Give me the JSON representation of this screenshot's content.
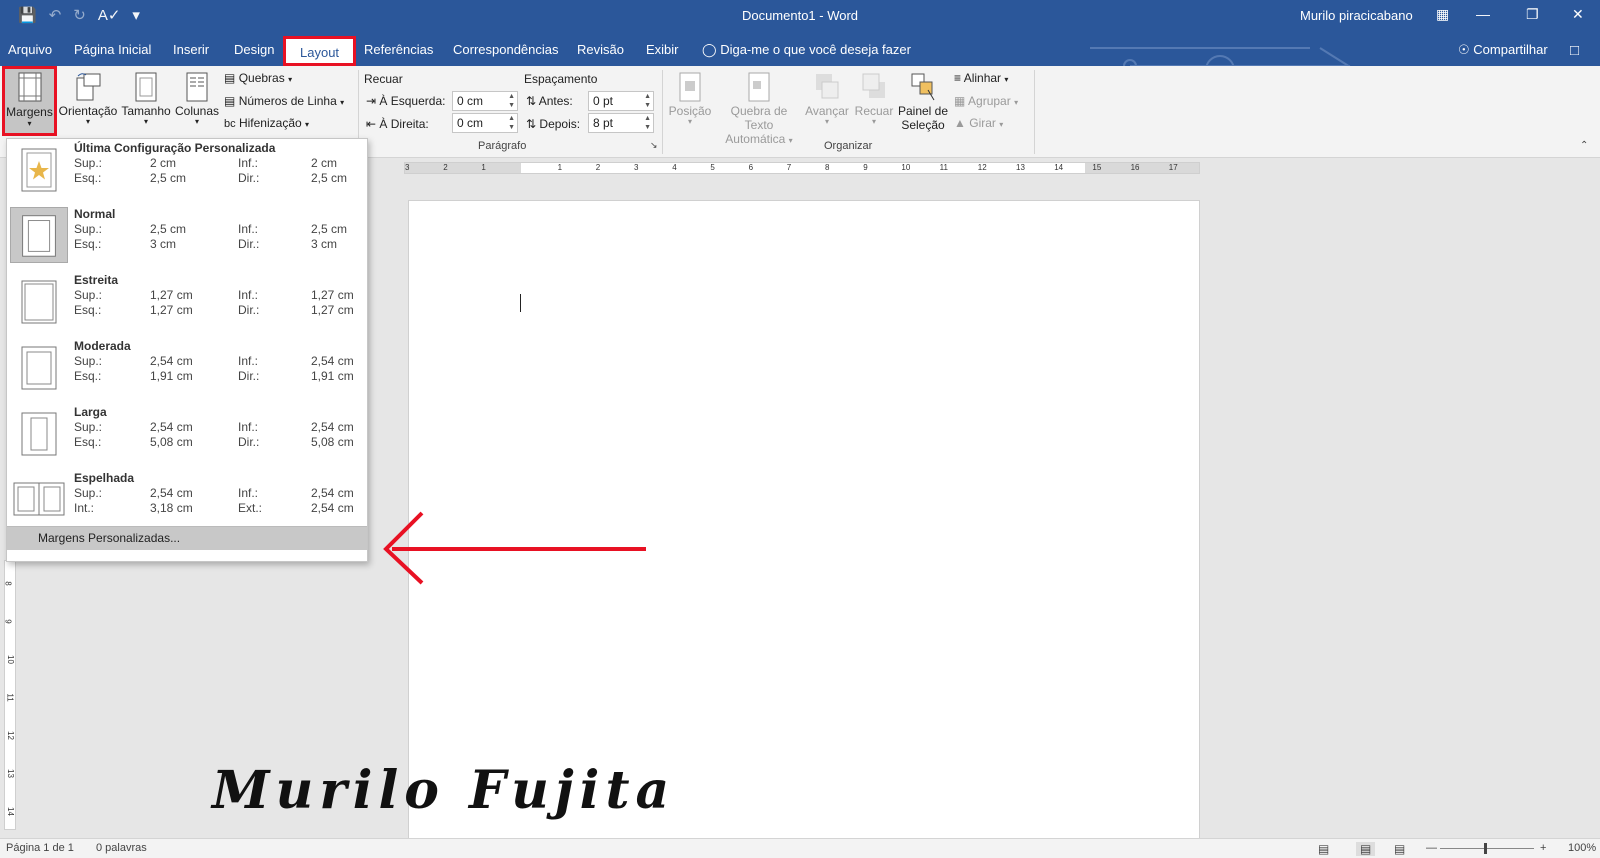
{
  "titlebar": {
    "title": "Documento1  -  Word",
    "user": "Murilo piracicabano"
  },
  "tabs": [
    "Arquivo",
    "Página Inicial",
    "Inserir",
    "Design",
    "Layout",
    "Referências",
    "Correspondências",
    "Revisão",
    "Exibir"
  ],
  "tellme": "Diga-me o que você deseja fazer",
  "share": "Compartilhar",
  "ribbon": {
    "margens": "Margens",
    "orientacao": "Orientação",
    "tamanho": "Tamanho",
    "colunas": "Colunas",
    "quebras": "Quebras",
    "numeros_linha": "Números de Linha",
    "hifenizacao": "Hifenização",
    "recuar": "Recuar",
    "espacamento": "Espaçamento",
    "esquerda_label": "À Esquerda:",
    "esquerda_value": "0 cm",
    "direita_label": "À Direita:",
    "direita_value": "0 cm",
    "antes_label": "Antes:",
    "antes_value": "0 pt",
    "depois_label": "Depois:",
    "depois_value": "8 pt",
    "paragrafo": "Parágrafo",
    "posicao": "Posição",
    "quebra_texto_1": "Quebra de Texto",
    "quebra_texto_2": "Automática",
    "avancar": "Avançar",
    "recuar_org": "Recuar",
    "painel_1": "Painel de",
    "painel_2": "Seleção",
    "alinhar": "Alinhar",
    "agrupar": "Agrupar",
    "girar": "Girar",
    "organizar": "Organizar"
  },
  "menu": {
    "items": [
      {
        "name": "Última Configuração Personalizada",
        "l1": "Sup.:",
        "v1": "2 cm",
        "l2": "Inf.:",
        "v2": "2 cm",
        "l3": "Esq.:",
        "v3": "2,5 cm",
        "l4": "Dir.:",
        "v4": "2,5 cm"
      },
      {
        "name": "Normal",
        "l1": "Sup.:",
        "v1": "2,5 cm",
        "l2": "Inf.:",
        "v2": "2,5 cm",
        "l3": "Esq.:",
        "v3": "3 cm",
        "l4": "Dir.:",
        "v4": "3 cm"
      },
      {
        "name": "Estreita",
        "l1": "Sup.:",
        "v1": "1,27 cm",
        "l2": "Inf.:",
        "v2": "1,27 cm",
        "l3": "Esq.:",
        "v3": "1,27 cm",
        "l4": "Dir.:",
        "v4": "1,27 cm"
      },
      {
        "name": "Moderada",
        "l1": "Sup.:",
        "v1": "2,54 cm",
        "l2": "Inf.:",
        "v2": "2,54 cm",
        "l3": "Esq.:",
        "v3": "1,91 cm",
        "l4": "Dir.:",
        "v4": "1,91 cm"
      },
      {
        "name": "Larga",
        "l1": "Sup.:",
        "v1": "2,54 cm",
        "l2": "Inf.:",
        "v2": "2,54 cm",
        "l3": "Esq.:",
        "v3": "5,08 cm",
        "l4": "Dir.:",
        "v4": "5,08 cm"
      },
      {
        "name": "Espelhada",
        "l1": "Sup.:",
        "v1": "2,54 cm",
        "l2": "Inf.:",
        "v2": "2,54 cm",
        "l3": "Int.:",
        "v3": "3,18 cm",
        "l4": "Ext.:",
        "v4": "2,54 cm"
      }
    ],
    "custom": "Margens Personalizadas..."
  },
  "ruler_numbers": [
    "3",
    "2",
    "1",
    "1",
    "2",
    "3",
    "4",
    "5",
    "6",
    "7",
    "8",
    "9",
    "10",
    "11",
    "12",
    "13",
    "14",
    "15",
    "16",
    "17"
  ],
  "vruler_numbers": [
    "8",
    "9",
    "10",
    "11",
    "12",
    "13",
    "14"
  ],
  "status": {
    "page": "Página 1 de 1",
    "words": "0 palavras",
    "zoom": "100%"
  },
  "signature": "Murilo Fujita",
  "colors": {
    "accent": "#2b579a",
    "highlight": "#e81123"
  }
}
